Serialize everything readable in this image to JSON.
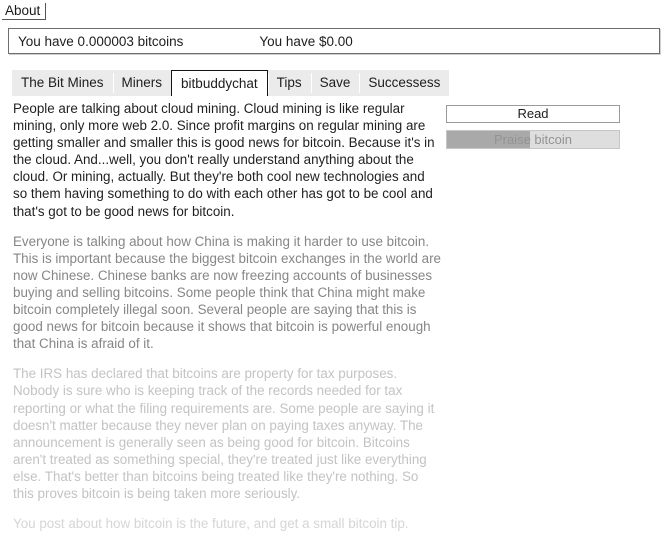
{
  "topbar": {
    "about_label": "About"
  },
  "status": {
    "bitcoins_text": "You have 0.000003 bitcoins",
    "dollars_text": "You have $0.00"
  },
  "tabs": [
    {
      "label": "The Bit Mines",
      "active": false
    },
    {
      "label": "Miners",
      "active": false
    },
    {
      "label": "bitbuddychat",
      "active": true
    },
    {
      "label": "Tips",
      "active": false
    },
    {
      "label": "Save",
      "active": false
    },
    {
      "label": "Successess",
      "active": false
    }
  ],
  "actions": {
    "read_label": "Read",
    "praise_label": "Praise bitcoin",
    "praise_progress_percent": 48
  },
  "feed": {
    "posts": [
      {
        "text": "People are talking about cloud mining. Cloud mining is like regular mining, only more web 2.0. Since profit margins on regular mining are getting smaller and smaller this is good news for bitcoin. Because it's in the cloud. And...well, you don't really understand anything about the cloud. Or mining, actually. But they're both cool new technologies and so them having something to do with each other has got to be cool and that's got to be good news for bitcoin."
      },
      {
        "text": "Everyone is talking about how China is making it harder to use bitcoin. This is important because the biggest bitcoin exchanges in the world are now Chinese. Chinese banks are now freezing accounts of businesses buying and selling bitcoins. Some people think that China might make bitcoin completely illegal soon. Several people are saying that this is good news for bitcoin because it shows that bitcoin is powerful enough that China is afraid of it."
      },
      {
        "text": "The IRS has declared that bitcoins are property for tax purposes. Nobody is sure who is keeping track of the records needed for tax reporting or what the filing requirements are. Some people are saying it doesn't matter because they never plan on paying taxes anyway. The announcement is generally seen as being good for bitcoin. Bitcoins aren't treated as something special, they're treated just like everything else. That's better than bitcoins being treated like they're nothing. So this proves bitcoin is being taken more seriously."
      },
      {
        "text": "You post about how bitcoin is the future, and get a small bitcoin tip."
      }
    ]
  },
  "colors": {
    "tab_inactive_bg": "#ebebeb",
    "tab_active_bg": "#ffffff",
    "progress_fill": "#a9a9a9",
    "progress_track": "#dedede"
  }
}
